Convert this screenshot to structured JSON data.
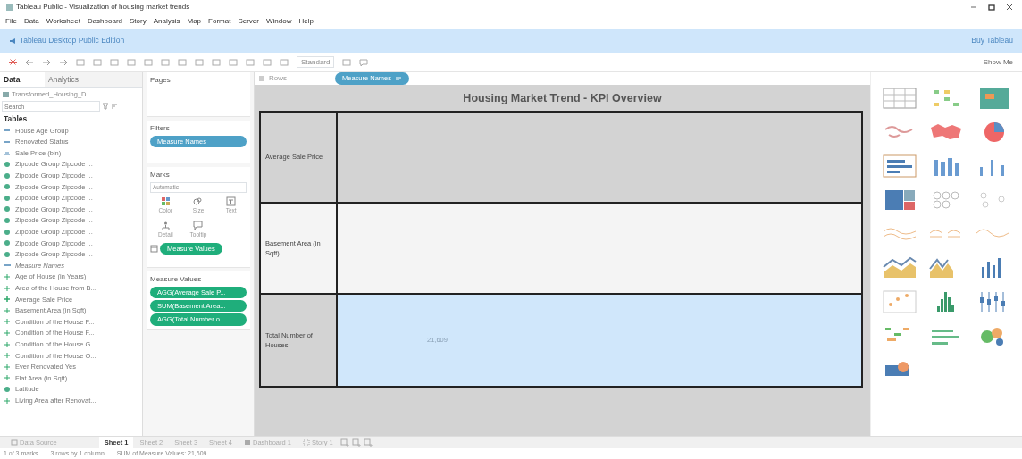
{
  "window": {
    "title": "Tableau Public - Visualization of housing market trends"
  },
  "menu": [
    "File",
    "Data",
    "Worksheet",
    "Dashboard",
    "Story",
    "Analysis",
    "Map",
    "Format",
    "Server",
    "Window",
    "Help"
  ],
  "banner": {
    "edition": "Tableau Desktop Public Edition",
    "buy": "Buy Tableau"
  },
  "toolbar": {
    "fit": "Standard",
    "show_me": "Show Me"
  },
  "data_pane": {
    "tabs": [
      {
        "label": "Data",
        "selected": true
      },
      {
        "label": "Analytics",
        "selected": false
      }
    ],
    "source": "Transformed_Housing_D...",
    "search_placeholder": "Search",
    "tables_heading": "Tables",
    "fields": [
      {
        "name": "House Age Group",
        "kind": "dimension"
      },
      {
        "name": "Renovated Status",
        "kind": "dimension"
      },
      {
        "name": "Sale Price (bin)",
        "kind": "bin"
      },
      {
        "name": "Zipcode Group Zipcode ...",
        "kind": "geo"
      },
      {
        "name": "Zipcode Group Zipcode ...",
        "kind": "geo"
      },
      {
        "name": "Zipcode Group Zipcode ...",
        "kind": "geo"
      },
      {
        "name": "Zipcode Group Zipcode ...",
        "kind": "geo"
      },
      {
        "name": "Zipcode Group Zipcode ...",
        "kind": "geo"
      },
      {
        "name": "Zipcode Group Zipcode ...",
        "kind": "geo"
      },
      {
        "name": "Zipcode Group Zipcode ...",
        "kind": "geo"
      },
      {
        "name": "Zipcode Group Zipcode ...",
        "kind": "geo"
      },
      {
        "name": "Zipcode Group Zipcode ...",
        "kind": "geo"
      },
      {
        "name": "Measure Names",
        "kind": "names"
      },
      {
        "name": "Age of House (in Years)",
        "kind": "measure"
      },
      {
        "name": "Area of the House from B...",
        "kind": "measure"
      },
      {
        "name": "Average Sale Price",
        "kind": "calc"
      },
      {
        "name": "Basement Area (in Sqft)",
        "kind": "measure"
      },
      {
        "name": "Condition of the House F...",
        "kind": "measure"
      },
      {
        "name": "Condition of the House F...",
        "kind": "measure"
      },
      {
        "name": "Condition of the House G...",
        "kind": "measure"
      },
      {
        "name": "Condition of the House O...",
        "kind": "measure"
      },
      {
        "name": "Ever Renovated Yes",
        "kind": "measure"
      },
      {
        "name": "Flat Area (in Sqft)",
        "kind": "measure"
      },
      {
        "name": "Latitude",
        "kind": "geo"
      },
      {
        "name": "Living Area after Renovat...",
        "kind": "measure"
      }
    ]
  },
  "cards": {
    "pages": "Pages",
    "filters": {
      "title": "Filters",
      "pills": [
        "Measure Names"
      ]
    },
    "marks": {
      "title": "Marks",
      "type": "Automatic",
      "buttons": [
        {
          "label": "Color",
          "kind": "color"
        },
        {
          "label": "Size",
          "kind": "size"
        },
        {
          "label": "Text",
          "kind": "text"
        },
        {
          "label": "Detail",
          "kind": "detail"
        },
        {
          "label": "Tooltip",
          "kind": "tooltip"
        }
      ],
      "text_pill": "Measure Values"
    },
    "measure_values": {
      "title": "Measure Values",
      "pills": [
        "AGG(Average Sale P...",
        "SUM(Basement Area...",
        "AGG(Total Number o..."
      ]
    }
  },
  "shelf": {
    "rows_label": "Rows",
    "pill": "Measure Names"
  },
  "view": {
    "title": "Housing Market Trend - KPI Overview",
    "rows": [
      {
        "label": "Average Sale Price",
        "selected": false
      },
      {
        "label": "Basement Area (in Sqft)",
        "selected": false
      },
      {
        "label": "Total Number of Houses",
        "value": "21,609",
        "selected": true
      }
    ]
  },
  "sheet_tabs": [
    {
      "label": "Data Source",
      "kind": "source",
      "selected": false
    },
    {
      "label": "Sheet 1",
      "kind": "sheet",
      "selected": true
    },
    {
      "label": "Sheet 2",
      "kind": "sheet",
      "selected": false
    },
    {
      "label": "Sheet 3",
      "kind": "sheet",
      "selected": false
    },
    {
      "label": "Sheet 4",
      "kind": "sheet",
      "selected": false
    },
    {
      "label": "Dashboard 1",
      "kind": "dashboard",
      "selected": false
    },
    {
      "label": "Story 1",
      "kind": "story",
      "selected": false
    }
  ],
  "status_bar": [
    "1 of 3 marks",
    "3 rows by 1 column",
    "SUM of Measure Values: 21,609"
  ]
}
